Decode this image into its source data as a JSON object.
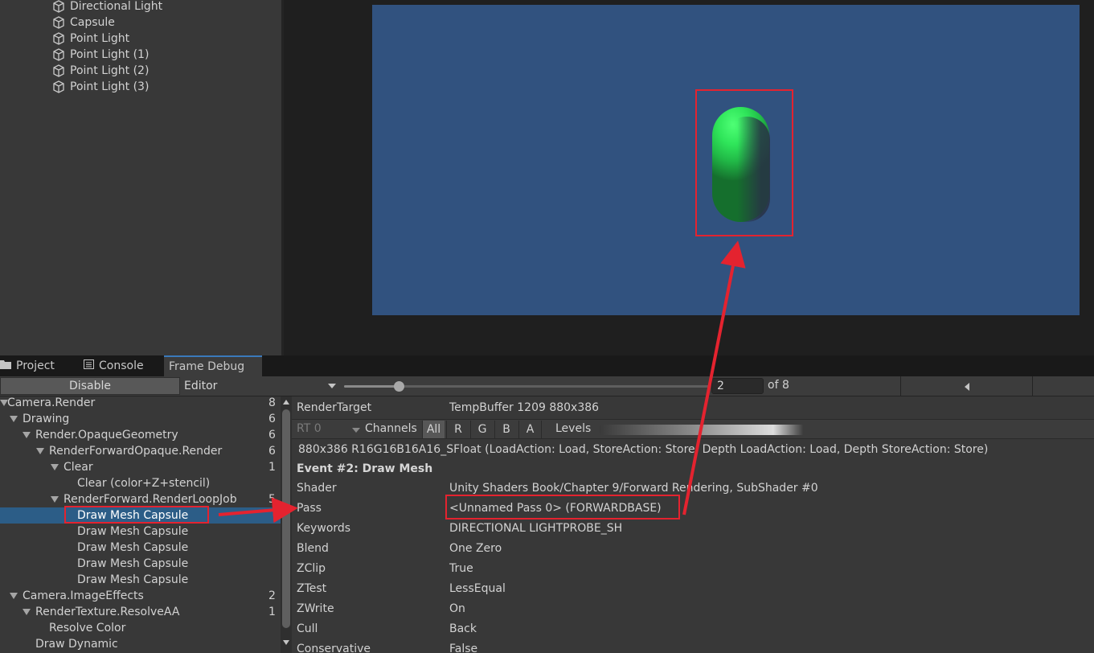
{
  "hierarchy": {
    "items": [
      {
        "label": "Directional Light",
        "icon": "gameobject-cube-icon"
      },
      {
        "label": "Capsule",
        "icon": "gameobject-cube-icon"
      },
      {
        "label": "Point Light",
        "icon": "gameobject-cube-icon"
      },
      {
        "label": "Point Light (1)",
        "icon": "gameobject-cube-icon"
      },
      {
        "label": "Point Light (2)",
        "icon": "gameobject-cube-icon"
      },
      {
        "label": "Point Light (3)",
        "icon": "gameobject-cube-icon"
      }
    ]
  },
  "game_view": {
    "background_color": "#31527f",
    "capsule_color": "#2fe55a",
    "highlight_color": "#e4232f"
  },
  "tabs": {
    "project": "Project",
    "console": "Console",
    "frame_debug": "Frame Debug"
  },
  "toolbar": {
    "disable_label": "Disable",
    "target_label": "Editor",
    "current_event": "2",
    "total_label": "of 8",
    "slider_fraction": 0.149
  },
  "tree": {
    "rows": [
      {
        "label": "Camera.Render",
        "count": "8",
        "expanded": true
      },
      {
        "label": "Drawing",
        "count": "6",
        "expanded": true
      },
      {
        "label": "Render.OpaqueGeometry",
        "count": "6",
        "expanded": true
      },
      {
        "label": "RenderForwardOpaque.Render",
        "count": "6",
        "expanded": true
      },
      {
        "label": "Clear",
        "count": "1",
        "expanded": true
      },
      {
        "label": "Clear (color+Z+stencil)",
        "count": ""
      },
      {
        "label": "RenderForward.RenderLoopJob",
        "count": "5",
        "expanded": true
      },
      {
        "label": "Draw Mesh Capsule",
        "count": "",
        "selected": true
      },
      {
        "label": "Draw Mesh Capsule",
        "count": ""
      },
      {
        "label": "Draw Mesh Capsule",
        "count": ""
      },
      {
        "label": "Draw Mesh Capsule",
        "count": ""
      },
      {
        "label": "Draw Mesh Capsule",
        "count": ""
      },
      {
        "label": "Camera.ImageEffects",
        "count": "2",
        "expanded": true
      },
      {
        "label": "RenderTexture.ResolveAA",
        "count": "1",
        "expanded": true
      },
      {
        "label": "Resolve Color",
        "count": ""
      },
      {
        "label": "Draw Dynamic",
        "count": ""
      }
    ]
  },
  "details": {
    "render_target_label": "RenderTarget",
    "render_target_value": "TempBuffer 1209 880x386",
    "rt_dropdown": "RT 0",
    "channels_label": "Channels",
    "channels": [
      "All",
      "R",
      "G",
      "B",
      "A"
    ],
    "levels_label": "Levels",
    "format_line": "880x386 R16G16B16A16_SFloat (LoadAction: Load, StoreAction: Store, Depth LoadAction: Load, Depth StoreAction: Store)",
    "event_title": "Event #2: Draw Mesh",
    "properties": [
      {
        "label": "Shader",
        "value": "Unity Shaders Book/Chapter 9/Forward Rendering, SubShader #0"
      },
      {
        "label": "Pass",
        "value": "<Unnamed Pass 0> (FORWARDBASE)"
      },
      {
        "label": "Keywords",
        "value": "DIRECTIONAL LIGHTPROBE_SH"
      },
      {
        "label": "Blend",
        "value": "One Zero"
      },
      {
        "label": "ZClip",
        "value": "True"
      },
      {
        "label": "ZTest",
        "value": "LessEqual"
      },
      {
        "label": "ZWrite",
        "value": "On"
      },
      {
        "label": "Cull",
        "value": "Back"
      },
      {
        "label": "Conservative",
        "value": "False"
      }
    ]
  }
}
